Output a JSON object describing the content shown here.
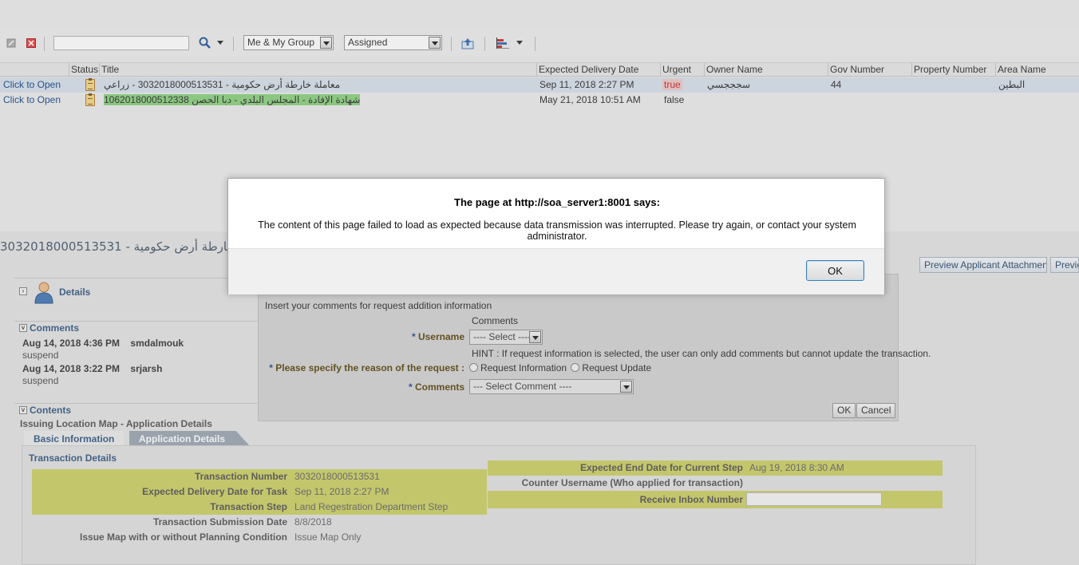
{
  "toolbar": {
    "filter_group": "Me & My Group",
    "filter_state": "Assigned",
    "search_value": ""
  },
  "table": {
    "columns": [
      "Status",
      "Title",
      "Expected Delivery Date",
      "Urgent",
      "Owner Name",
      "Gov Number",
      "Property Number",
      "Area Name"
    ],
    "rows": [
      {
        "link": "Click to Open",
        "title": "معاملة خارطة أرض حكومية - 3032018000513531 - زراعي",
        "date": "Sep 11, 2018 2:27 PM",
        "urgent": "true",
        "owner": "سجججسي",
        "gov": "44",
        "property": "",
        "area": "البطين"
      },
      {
        "link": "Click to Open",
        "title": "شهادة الإفادة - المجلس البلدي - دبا الحصن 1062018000512338",
        "date": "May 21, 2018 10:51 AM",
        "urgent": "false",
        "owner": "",
        "gov": "",
        "property": "",
        "area": ""
      }
    ]
  },
  "task": {
    "title": "3032018000513531 - خارطة أرض حكومية",
    "details_label": "Details",
    "comments_label": "Comments",
    "comments": [
      {
        "date": "Aug 14, 2018 4:36 PM",
        "user": "smdalmouk",
        "text": "suspend"
      },
      {
        "date": "Aug 14, 2018 3:22 PM",
        "user": "srjarsh",
        "text": "suspend"
      }
    ],
    "contents_label": "Contents",
    "contents_sub": "Issuing Location Map - Application Details",
    "tab_basic": "Basic Information",
    "tab_app": "Application Details",
    "preview_btn": "Preview Applicant Attachments",
    "preview_btn2": "Previe",
    "transaction_details": "Transaction Details",
    "fields_left": [
      {
        "label": "Transaction Number",
        "value": "3032018000513531"
      },
      {
        "label": "Expected Delivery Date for Task",
        "value": "Sep 11, 2018 2:27 PM"
      },
      {
        "label": "Transaction Step",
        "value": "Land Regestration Department Step"
      },
      {
        "label": "Transaction Submission Date",
        "value": "8/8/2018"
      },
      {
        "label": "Issue Map with or without Planning Condition",
        "value": "Issue Map Only"
      }
    ],
    "fields_right": [
      {
        "label": "Expected End Date for Current Step",
        "value": "Aug 19, 2018 8:30 AM"
      },
      {
        "label": "Counter Username (Who applied for transaction)",
        "value": ""
      },
      {
        "label": "Receive Inbox Number",
        "value": ""
      }
    ]
  },
  "request_popup": {
    "intro": "Insert your comments for request addition information",
    "comments_caption": "Comments",
    "username_label": "Username",
    "username_select": "---- Select ----",
    "hint": "HINT : If request information is selected, the user can only add comments but cannot update the transaction.",
    "reason_label": "Please specify the reason of the request :",
    "opt_info": "Request Information",
    "opt_update": "Request Update",
    "comments_label": "Comments",
    "comments_select": "--- Select Comment ----",
    "ok": "OK",
    "cancel": "Cancel"
  },
  "alert": {
    "title": "The page at http://soa_server1:8001 says:",
    "message": "The content of this page failed to load as expected because data transmission was interrupted. Please try again, or contact your system administrator.",
    "ok": "OK"
  },
  "colors": {
    "highlight_green": "#8fd282",
    "field_yellow": "#ced16a",
    "link_blue": "#1a4e8a",
    "section_blue": "#3b5f87"
  }
}
